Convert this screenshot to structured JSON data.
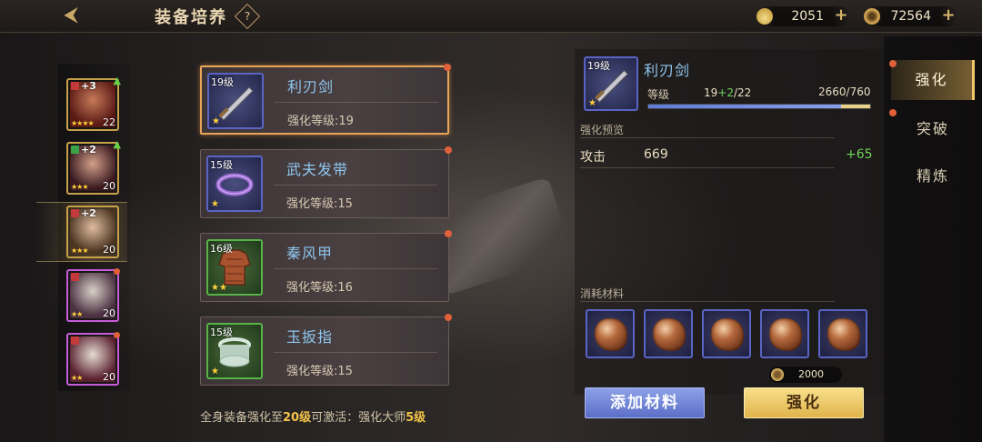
{
  "header": {
    "title": "装备培养",
    "help_symbol": "?",
    "back_symbol": "⮜",
    "resources": [
      {
        "icon": "yuanbao-ingot-icon",
        "value": "2051"
      },
      {
        "icon": "copper-coin-icon",
        "value": "72564"
      }
    ]
  },
  "heroes": [
    {
      "plus": "+3",
      "level": "22",
      "stars": "★★★★",
      "frame": "gold",
      "upgrade": true
    },
    {
      "plus": "+2",
      "level": "20",
      "stars": "★★★",
      "frame": "gold",
      "upgrade": true
    },
    {
      "plus": "+2",
      "level": "20",
      "stars": "★★★",
      "frame": "gold",
      "selected": true
    },
    {
      "plus": "",
      "level": "20",
      "stars": "★★",
      "frame": "purple"
    },
    {
      "plus": "",
      "level": "20",
      "stars": "★★",
      "frame": "purple"
    }
  ],
  "equipment": [
    {
      "level_tag": "19级",
      "name": "利刃剑",
      "enhance_label": "强化等级:19",
      "stars": "★",
      "frame": "blue",
      "selected": true
    },
    {
      "level_tag": "15级",
      "name": "武夫发带",
      "enhance_label": "强化等级:15",
      "stars": "★",
      "frame": "blue"
    },
    {
      "level_tag": "16级",
      "name": "秦风甲",
      "enhance_label": "强化等级:16",
      "stars": "★★",
      "frame": "green"
    },
    {
      "level_tag": "15级",
      "name": "玉扳指",
      "enhance_label": "强化等级:15",
      "stars": "★",
      "frame": "green"
    }
  ],
  "activation_note": {
    "prefix": "全身装备强化至",
    "level": "20级",
    "middle": "可激活：强化大师",
    "tier": "5级"
  },
  "detail": {
    "level_tag": "19级",
    "stars": "★",
    "name": "利刃剑",
    "level_label": "等级",
    "level_current": "19",
    "level_gain": "+2",
    "level_max": "/22",
    "exp_text": "2660/760",
    "exp_fill": 1.0,
    "preview_title": "强化预览",
    "stat_name": "攻击",
    "stat_value": "669",
    "stat_gain": "+65",
    "materials_title": "消耗材料",
    "materials_count": 5,
    "cost": "2000",
    "add_button": "添加材料",
    "enhance_button": "强化"
  },
  "tabs": [
    {
      "label": "强化",
      "active": true,
      "dot": true
    },
    {
      "label": "突破",
      "active": false,
      "dot": true
    },
    {
      "label": "精炼",
      "active": false,
      "dot": false
    }
  ],
  "colors": {
    "accent_gold": "#f0c867",
    "name_blue": "#8fc7ef",
    "gain_green": "#6fd35a",
    "alert_red": "#e0603a"
  }
}
